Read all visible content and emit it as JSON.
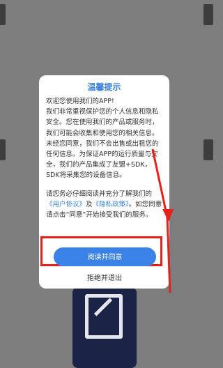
{
  "dialog": {
    "title": "温馨提示",
    "greeting": "欢迎您使用我们的APP!",
    "paragraph1": "我们非常重视保护您的个人信息和隐私安全。您在使用我们的产品或服务时，我们可能会收集和使用您的相关信息。未经您同意，我们不会出售或出租您的任何信息。为保证APP的运行质量与安全，我们的产品集成了友盟+SDK，SDK将采集您的设备信息。",
    "p2_before": "请您务必仔细阅读并充分了解我们的",
    "user_agreement": "《用户协议》",
    "p2_and": "及",
    "privacy_policy": "《隐私政策》",
    "p2_after": "。如您同意请点击“同意”开始接受我们的服务。",
    "agree_button": "阅读并同意",
    "refuse_link": "拒绝并退出"
  },
  "colors": {
    "accent": "#3b82e6",
    "annotation": "#e8201c",
    "overlay": "#7d7d7d"
  }
}
